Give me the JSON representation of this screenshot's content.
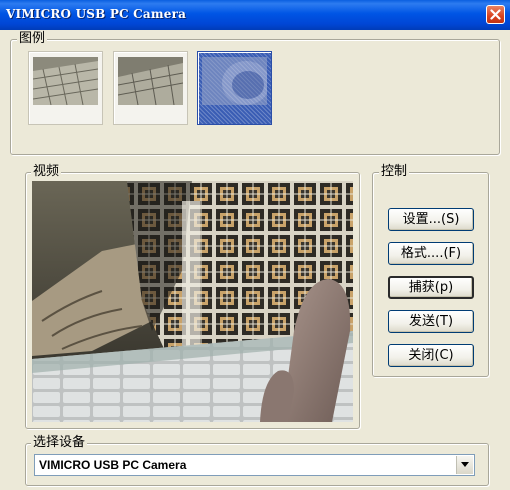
{
  "window": {
    "title": "VIMICRO USB PC Camera"
  },
  "legend": {
    "label": "图例"
  },
  "video": {
    "label": "视频"
  },
  "controls": {
    "label": "控制",
    "buttons": [
      {
        "label": "设置...(S)"
      },
      {
        "label": "格式....(F)"
      },
      {
        "label": "捕获(p)"
      },
      {
        "label": "发送(T)"
      },
      {
        "label": "关闭(C)"
      }
    ]
  },
  "device": {
    "label": "选择设备",
    "selected": "VIMICRO USB PC Camera"
  },
  "icons": [
    "close-icon",
    "chevron-down-icon"
  ],
  "colors": {
    "titlebar": "#0055e5",
    "dialog_bg": "#ece9d8",
    "selection": "#3a5db4"
  }
}
